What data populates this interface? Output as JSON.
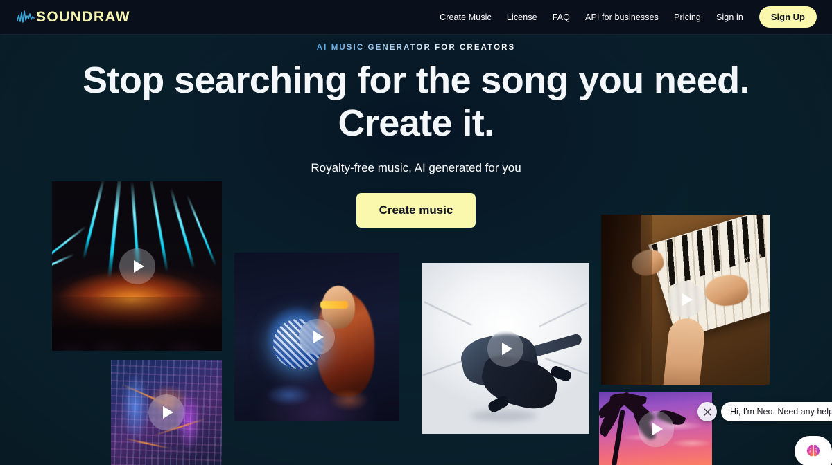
{
  "header": {
    "logo": {
      "icon": "soundwave-icon",
      "text": "SOUNDRAW"
    },
    "nav_links": [
      {
        "label": "Create Music"
      },
      {
        "label": "License"
      },
      {
        "label": "FAQ"
      },
      {
        "label": "API for businesses"
      },
      {
        "label": "Pricing"
      },
      {
        "label": "Sign in"
      }
    ],
    "signup_label": "Sign Up"
  },
  "hero": {
    "eyebrow": "AI MUSIC GENERATOR FOR CREATORS",
    "headline_line1": "Stop searching for the song you need.",
    "headline_line2": "Create it.",
    "subhead": "Royalty-free music, AI generated for you",
    "cta_label": "Create music"
  },
  "gallery": {
    "play_icon": "play-icon",
    "cards": [
      {
        "id": "concert",
        "name": "concert-lights-video"
      },
      {
        "id": "city",
        "name": "neon-city-video"
      },
      {
        "id": "disco",
        "name": "disco-ball-video"
      },
      {
        "id": "dancer",
        "name": "dancer-video"
      },
      {
        "id": "piano",
        "name": "piano-hands-video"
      },
      {
        "id": "tropical",
        "name": "tropical-sunset-video"
      }
    ],
    "piano_brand": "YAM"
  },
  "chat": {
    "message": "Hi, I'm Neo. Need any help?",
    "close_icon": "close-icon",
    "launcher_icon": "brain-icon"
  },
  "colors": {
    "accent_yellow": "#faf8ac",
    "header_bg": "#0a0f1c",
    "page_bg": "#0a2330",
    "text_white": "#ffffff"
  }
}
